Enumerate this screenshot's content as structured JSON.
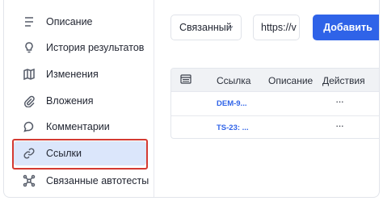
{
  "sidebar": {
    "items": [
      {
        "label": "Описание",
        "icon": "list-lines-icon"
      },
      {
        "label": "История результатов",
        "icon": "lightbulb-icon"
      },
      {
        "label": "Изменения",
        "icon": "map-icon"
      },
      {
        "label": "Вложения",
        "icon": "paperclip-icon"
      },
      {
        "label": "Комментарии",
        "icon": "speech-bubble-icon"
      },
      {
        "label": "Ссылки",
        "icon": "link-icon"
      },
      {
        "label": "Связанные автотесты",
        "icon": "network-nodes-icon"
      }
    ]
  },
  "toolbar": {
    "select_value": "Связанный",
    "url_value": "https://v",
    "add_label": "Добавить"
  },
  "table": {
    "columns": [
      "Ссылка",
      "Описание",
      "Действия"
    ],
    "rows": [
      {
        "link": "DEM-9...",
        "actions": "···"
      },
      {
        "link": "TS-23: ...",
        "actions": "···"
      }
    ]
  },
  "colors": {
    "accent": "#2f63e8",
    "active_bg": "#dbe6fb",
    "highlight": "#d43a32"
  }
}
